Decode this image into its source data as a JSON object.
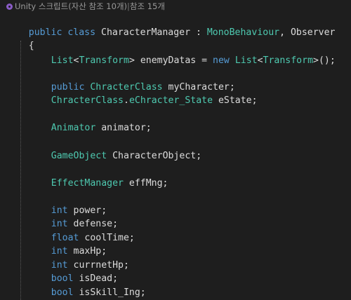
{
  "codelens": {
    "icon": "unity-icon",
    "unity_label": "Unity",
    "script_refs": "스크립트(자산 참조 10개)",
    "separator": "|",
    "refs": "참조 15개"
  },
  "colors": {
    "background": "#1e1e1e",
    "keyword": "#569cd6",
    "type": "#4ec9b0",
    "plain": "#dcdcdc",
    "codelens": "#999999"
  },
  "code": {
    "l1": [
      "public",
      " ",
      "class",
      " CharacterManager : ",
      "MonoBehaviour",
      ", Observer"
    ],
    "l2": [
      "{"
    ],
    "l3": [
      "List",
      "<",
      "Transform",
      "> enemyDatas = ",
      "new",
      " ",
      "List",
      "<",
      "Transform",
      ">();"
    ],
    "l4": [
      "public",
      " ",
      "ChracterClass",
      " myCharacter;"
    ],
    "l5": [
      "ChracterClass",
      ".",
      "eChracter_State",
      " eState;"
    ],
    "l6": [
      "Animator",
      " animator;"
    ],
    "l7": [
      "GameObject",
      " CharacterObject;"
    ],
    "l8": [
      "EffectManager",
      " effMng;"
    ],
    "l9": [
      "int",
      " power;"
    ],
    "l10": [
      "int",
      " defense;"
    ],
    "l11": [
      "float",
      " coolTime;"
    ],
    "l12": [
      "int",
      " maxHp;"
    ],
    "l13": [
      "int",
      " currnetHp;"
    ],
    "l14": [
      "bool",
      " isDead;"
    ],
    "l15": [
      "bool",
      " isSkill_Ing;"
    ]
  }
}
